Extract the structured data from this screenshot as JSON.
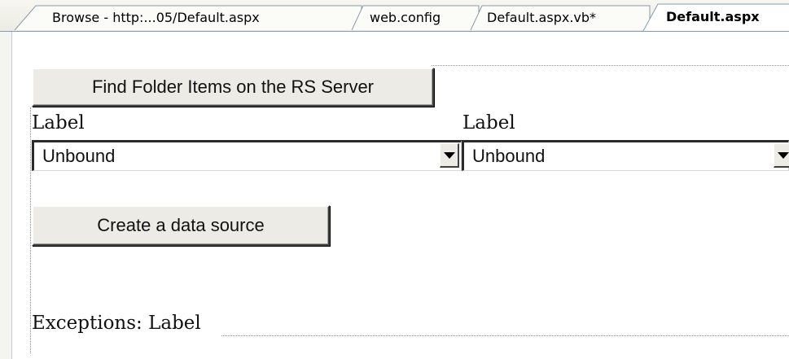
{
  "tabs": [
    {
      "label": "Browse - http:...05/Default.aspx",
      "active": false
    },
    {
      "label": "web.config",
      "active": false
    },
    {
      "label": "Default.aspx.vb*",
      "active": false
    },
    {
      "label": "Default.aspx",
      "active": true
    }
  ],
  "form": {
    "find_button_label": "Find Folder Items on the RS Server",
    "label_left": "Label",
    "label_right": "Label",
    "dropdown_left_value": "Unbound",
    "dropdown_right_value": "Unbound",
    "create_button_label": "Create a data source",
    "exceptions_label": "Exceptions: Label"
  },
  "icons": {
    "dropdown_arrow": "chevron-down-icon"
  },
  "colors": {
    "tab_border": "#7f9db9",
    "button_face": "#ecebe6"
  }
}
